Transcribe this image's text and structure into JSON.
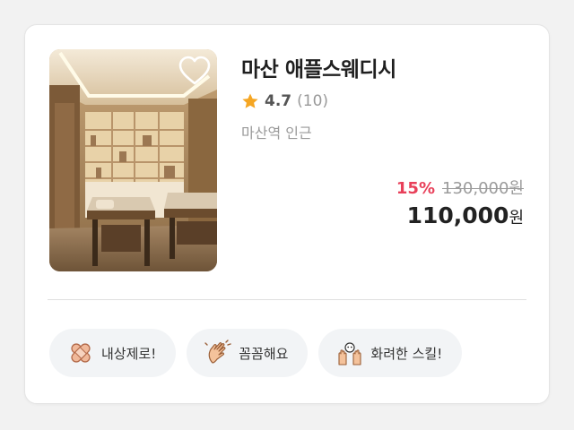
{
  "shop": {
    "name": "마산 애플스웨디시",
    "rating": "4.7",
    "review_count": "(10)",
    "location": "마산역 인근"
  },
  "price": {
    "discount": "15%",
    "original": "130,000원",
    "final": "110,000",
    "currency": "원"
  },
  "tags": [
    {
      "label": "내상제로!",
      "icon": "bandage-icon"
    },
    {
      "label": "꼼꼼해요",
      "icon": "clapping-hands-icon"
    },
    {
      "label": "화려한 스킬!",
      "icon": "massage-hands-icon"
    }
  ],
  "colors": {
    "discount": "#e8405a",
    "star": "#f5a623",
    "tag_bg": "#f2f4f6"
  }
}
